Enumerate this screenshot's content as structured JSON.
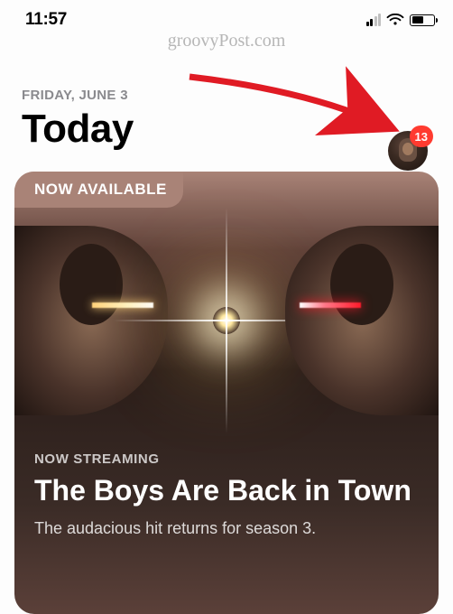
{
  "watermark": "groovyPost.com",
  "status": {
    "time": "11:57"
  },
  "header": {
    "date": "FRIDAY, JUNE 3",
    "title": "Today",
    "badge_count": "13"
  },
  "card": {
    "ribbon": "NOW AVAILABLE",
    "eyebrow": "NOW STREAMING",
    "headline": "The Boys Are Back in Town",
    "subtext": "The audacious hit returns for season 3."
  }
}
